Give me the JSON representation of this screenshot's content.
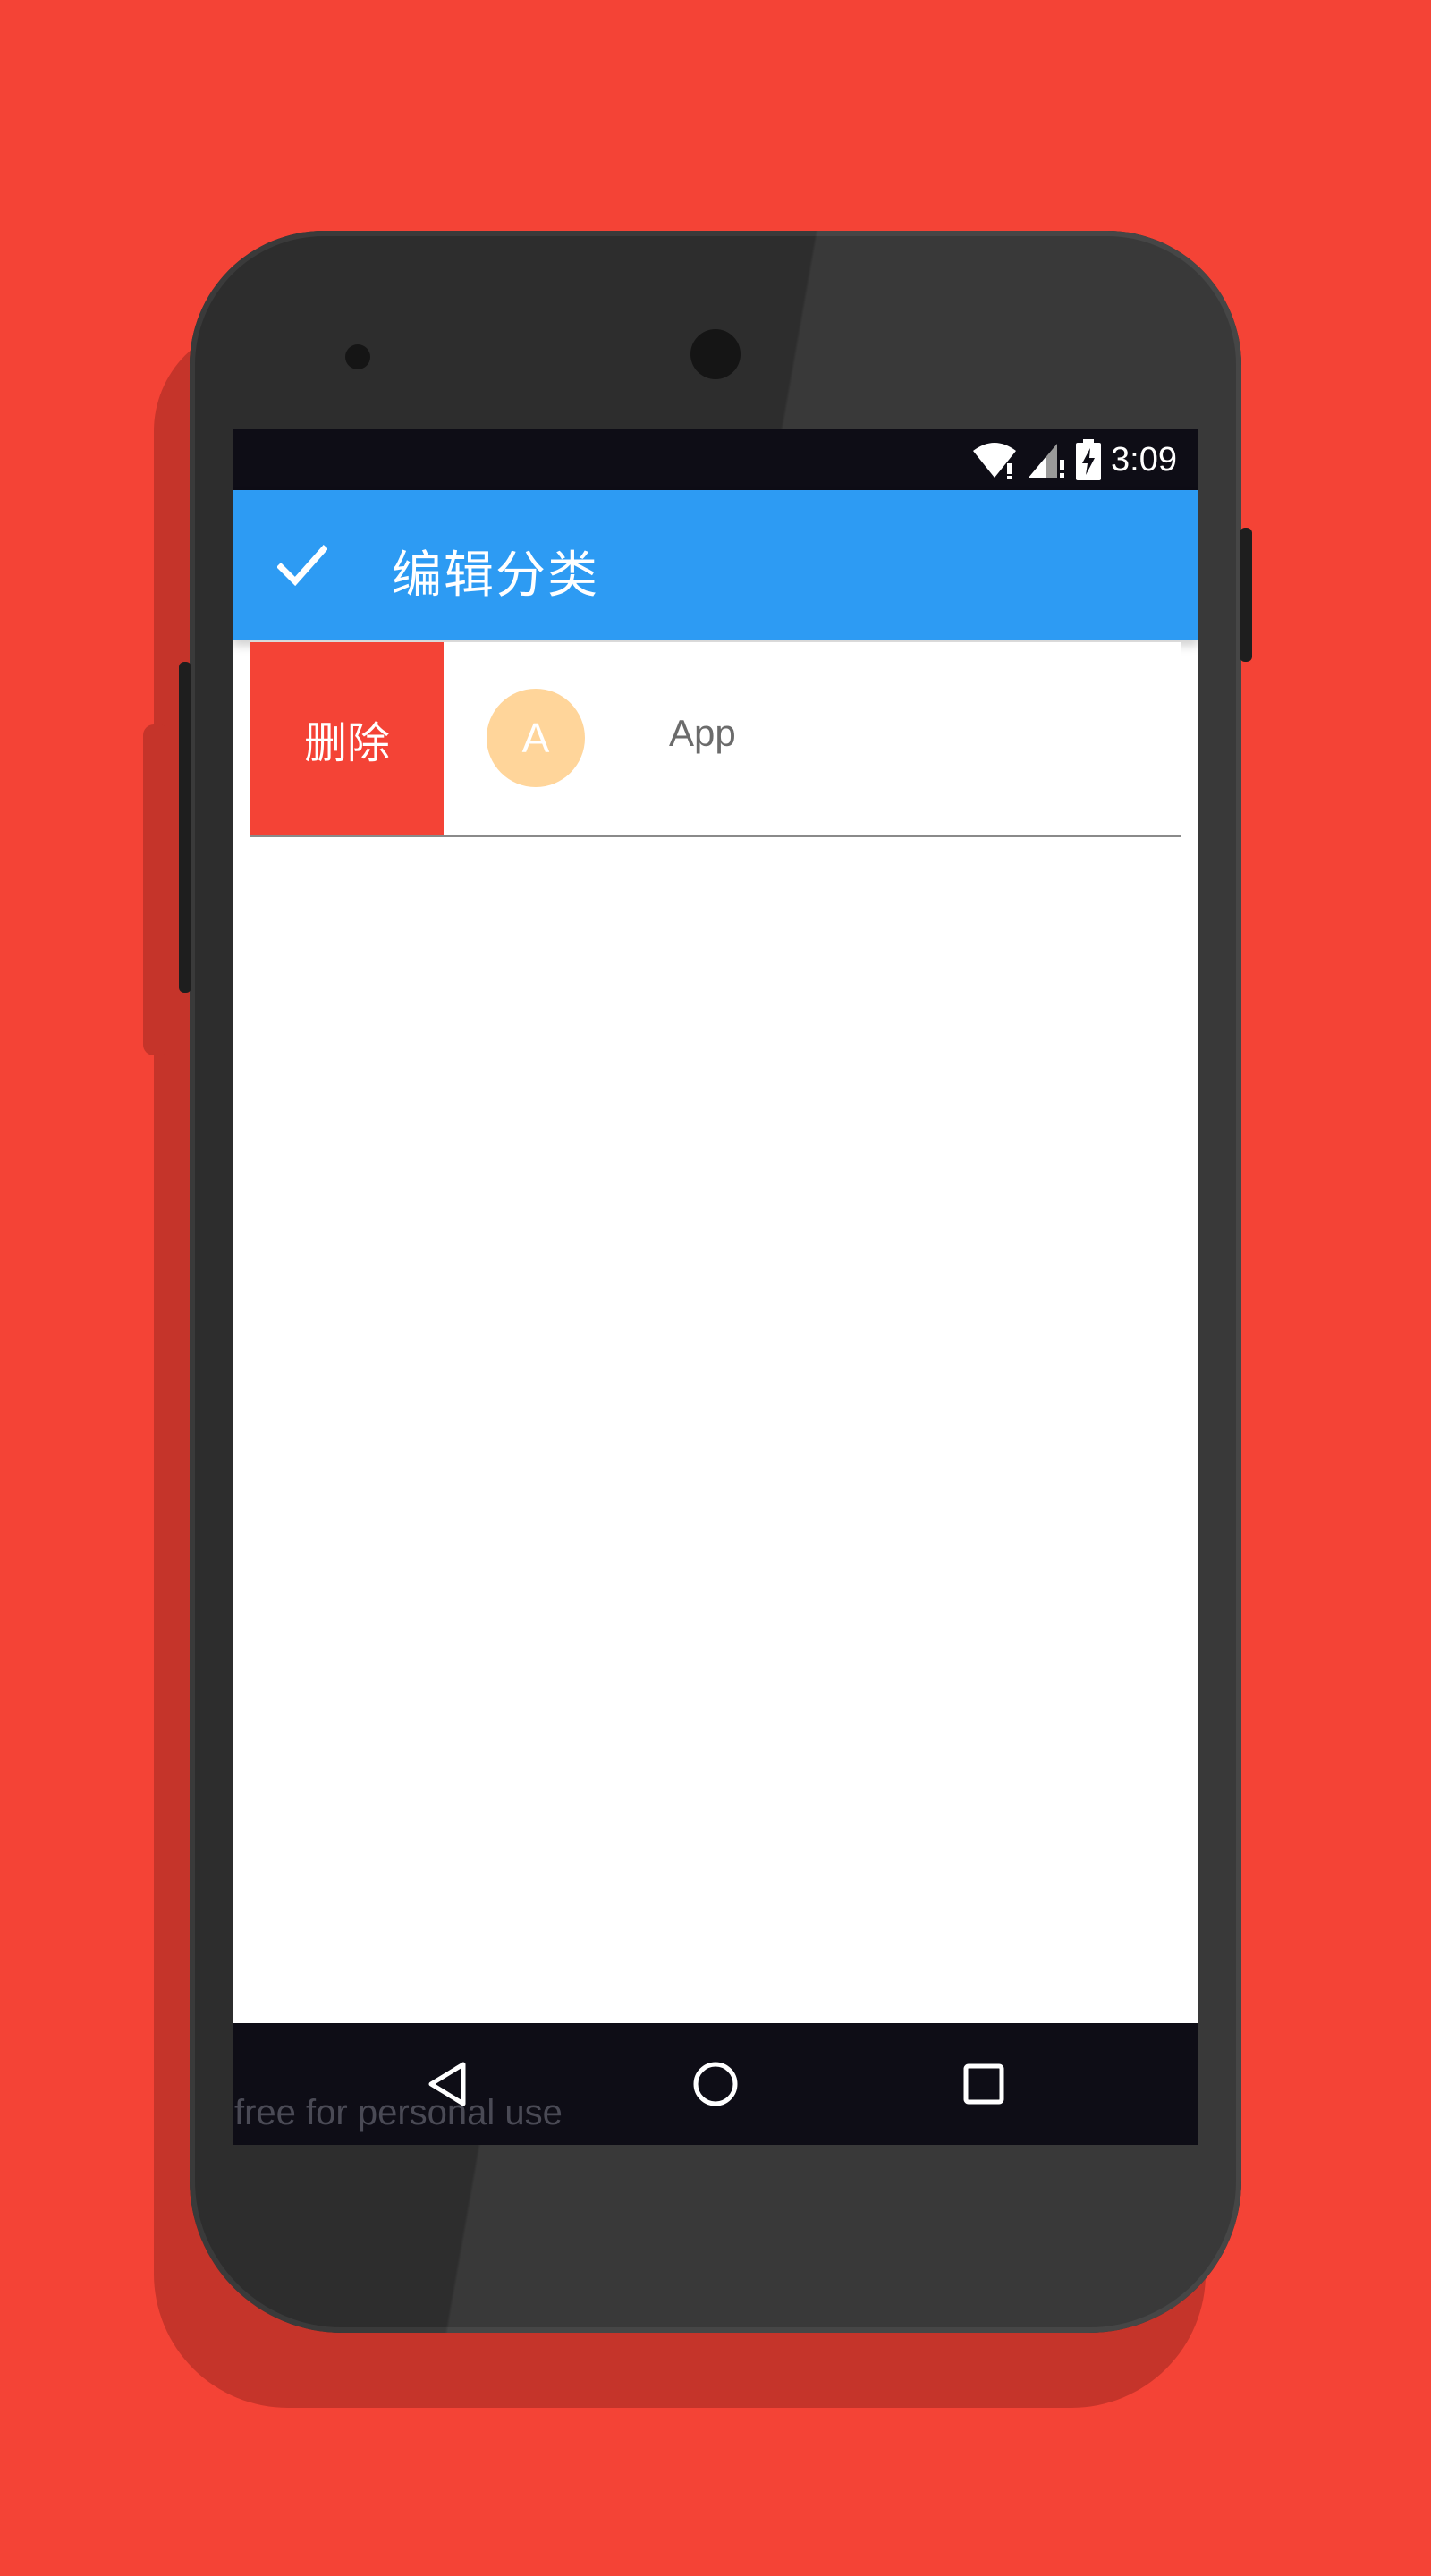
{
  "status_bar": {
    "time": "3:09",
    "icons": [
      "wifi-icon",
      "signal-icon",
      "battery-charging-icon"
    ]
  },
  "app_bar": {
    "confirm_icon": "check-icon",
    "title": "编辑分类"
  },
  "list": {
    "items": [
      {
        "delete_label": "删除",
        "avatar_letter": "A",
        "label": "App"
      }
    ]
  },
  "nav_bar": {
    "icons": [
      "back-icon",
      "home-icon",
      "recents-icon"
    ]
  },
  "watermark": "free for personal use",
  "colors": {
    "background": "#F44336",
    "app_bar": "#2D9BF3",
    "delete": "#F44336",
    "avatar": "#FFD59A",
    "system_bars": "#0e0d16"
  }
}
